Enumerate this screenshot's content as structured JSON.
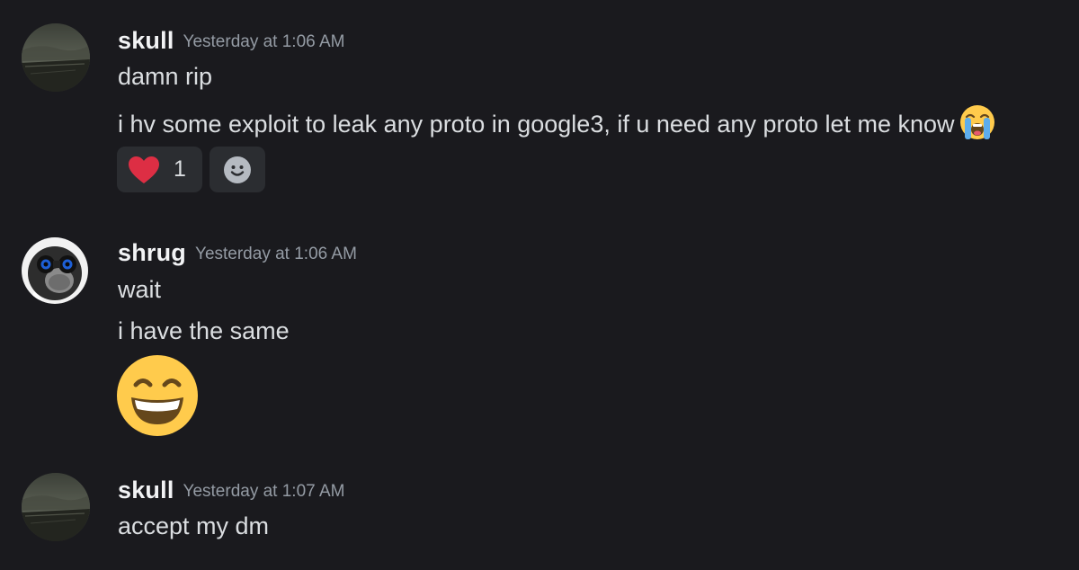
{
  "colors": {
    "background": "#1a1a1e",
    "username": "#f2f3f5",
    "timestamp": "#949ba4",
    "message_text": "#dbdee1",
    "reaction_bg": "#2b2d31",
    "heart": "#dd2e44",
    "emoji_face": "#ffcb4c"
  },
  "messages": [
    {
      "username": "skull",
      "timestamp": "Yesterday at 1:06 AM",
      "avatar_icon": "landscape-avatar",
      "lines": [
        "damn rip",
        "i hv some exploit to leak any proto in google3, if u need any proto let me know"
      ],
      "inline_emoji": "loudly-crying-face-emoji",
      "reactions": [
        {
          "emoji": "heart-emoji",
          "count": "1"
        },
        {
          "emoji": "add-reaction-smiley-icon"
        }
      ]
    },
    {
      "username": "shrug",
      "timestamp": "Yesterday at 1:06 AM",
      "avatar_icon": "binoculars-man-avatar",
      "lines": [
        "wait",
        "i have the same"
      ],
      "big_emoji": "grinning-squinting-face-emoji"
    },
    {
      "username": "skull",
      "timestamp": "Yesterday at 1:07 AM",
      "avatar_icon": "landscape-avatar",
      "lines": [
        "accept my dm"
      ]
    }
  ]
}
